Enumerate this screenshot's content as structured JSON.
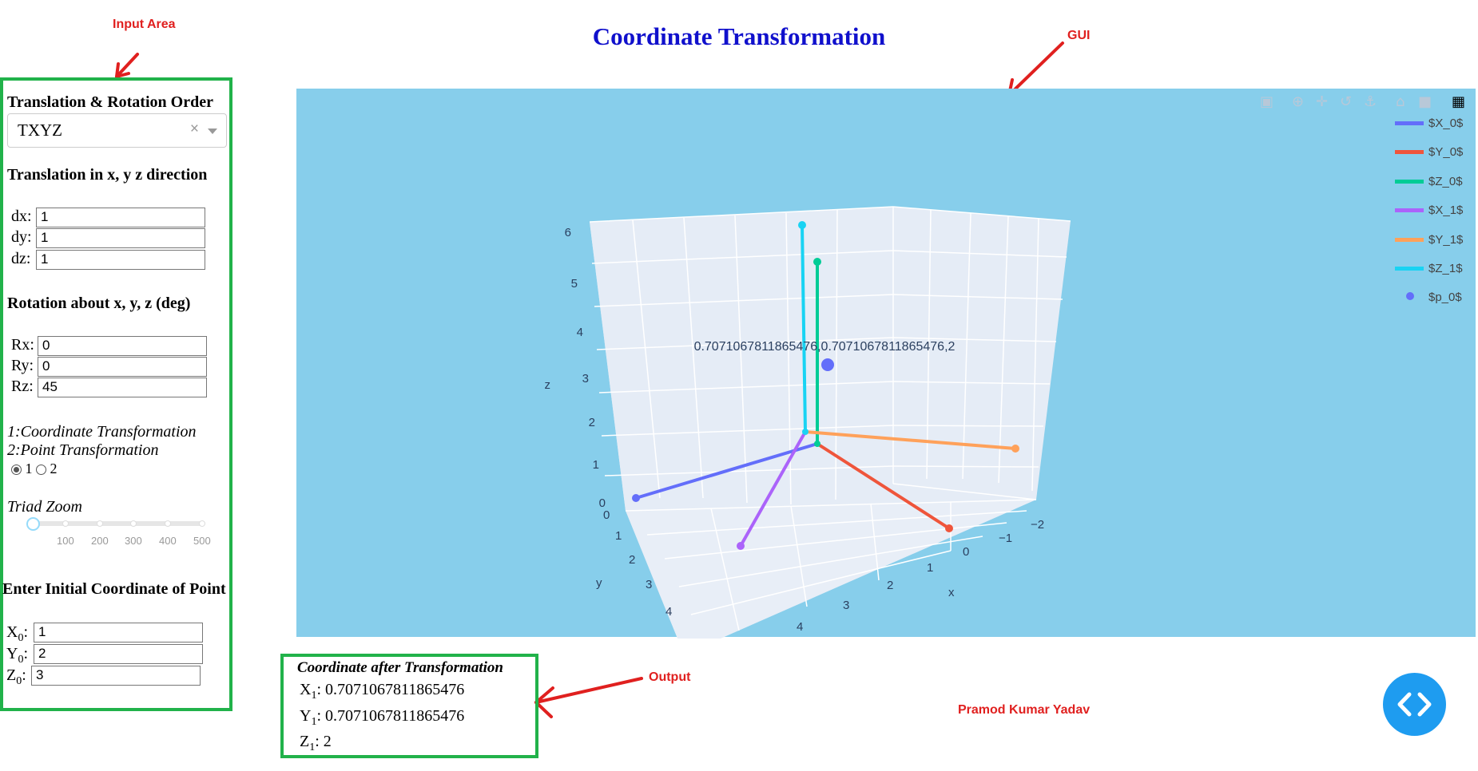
{
  "annotations": {
    "input_area": "Input Area",
    "gui": "GUI",
    "output": "Output",
    "author": "Pramod Kumar Yadav"
  },
  "page_title": "Coordinate Transformation",
  "inputs": {
    "order_title": "Translation & Rotation Order",
    "order_value": "TXYZ",
    "translation_title": "Translation in x, y z direction",
    "dx_label": "dx:",
    "dx": "1",
    "dy_label": "dy:",
    "dy": "1",
    "dz_label": "dz:",
    "dz": "1",
    "rotation_title": "Rotation about x, y, z (deg)",
    "rx_label": "Rx:",
    "rx": "0",
    "ry_label": "Ry:",
    "ry": "0",
    "rz_label": "Rz:",
    "rz": "45",
    "mode_line1": "1:Coordinate Transformation",
    "mode_line2": "2:Point Transformation",
    "mode_opt1": "1",
    "mode_opt2": "2",
    "mode_selected": "1",
    "zoom_title": "Triad Zoom",
    "zoom_ticks": [
      "100",
      "200",
      "300",
      "400",
      "500"
    ],
    "point_title": "Enter Initial Coordinate of Point",
    "x0_label": "X",
    "x0_sub": "0",
    "x0": "1",
    "y0_label": "Y",
    "y0_sub": "0",
    "y0": "2",
    "z0_label": "Z",
    "z0_sub": "0",
    "z0": "3"
  },
  "plot": {
    "background": "#87ceeb",
    "point_label": "0.7071067811865476,0.7071067811865476,2",
    "legend": [
      {
        "name": "$X_0$",
        "color": "#636efa"
      },
      {
        "name": "$Y_0$",
        "color": "#ef553b"
      },
      {
        "name": "$Z_0$",
        "color": "#00cc96"
      },
      {
        "name": "$X_1$",
        "color": "#ab63fa"
      },
      {
        "name": "$Y_1$",
        "color": "#ffa15a"
      },
      {
        "name": "$Z_1$",
        "color": "#19d3f3"
      },
      {
        "name": "$p_0$",
        "color": "#636efa"
      }
    ],
    "z_axis_title": "z",
    "z_ticks": [
      "0",
      "1",
      "2",
      "3",
      "4",
      "5",
      "6"
    ],
    "y_axis_title": "y",
    "y_ticks": [
      "0",
      "1",
      "2",
      "3",
      "4"
    ],
    "x_axis_title": "x",
    "x_ticks": [
      "−2",
      "−1",
      "0",
      "1",
      "2",
      "3",
      "4"
    ],
    "modebar_icons": [
      "camera-icon",
      "zoom-icon",
      "pan-icon",
      "orbit-icon",
      "turntable-icon",
      "home-icon",
      "camera-view-icon",
      "plotly-logo-icon"
    ]
  },
  "output": {
    "title": "Coordinate after Transformation",
    "x1_label": "X",
    "x1_sub": "1",
    "x1": "0.7071067811865476",
    "y1_label": "Y",
    "y1_sub": "1",
    "y1": "0.7071067811865476",
    "z1_label": "Z",
    "z1_sub": "1",
    "z1": "2"
  },
  "fab_icon": "code-icon"
}
